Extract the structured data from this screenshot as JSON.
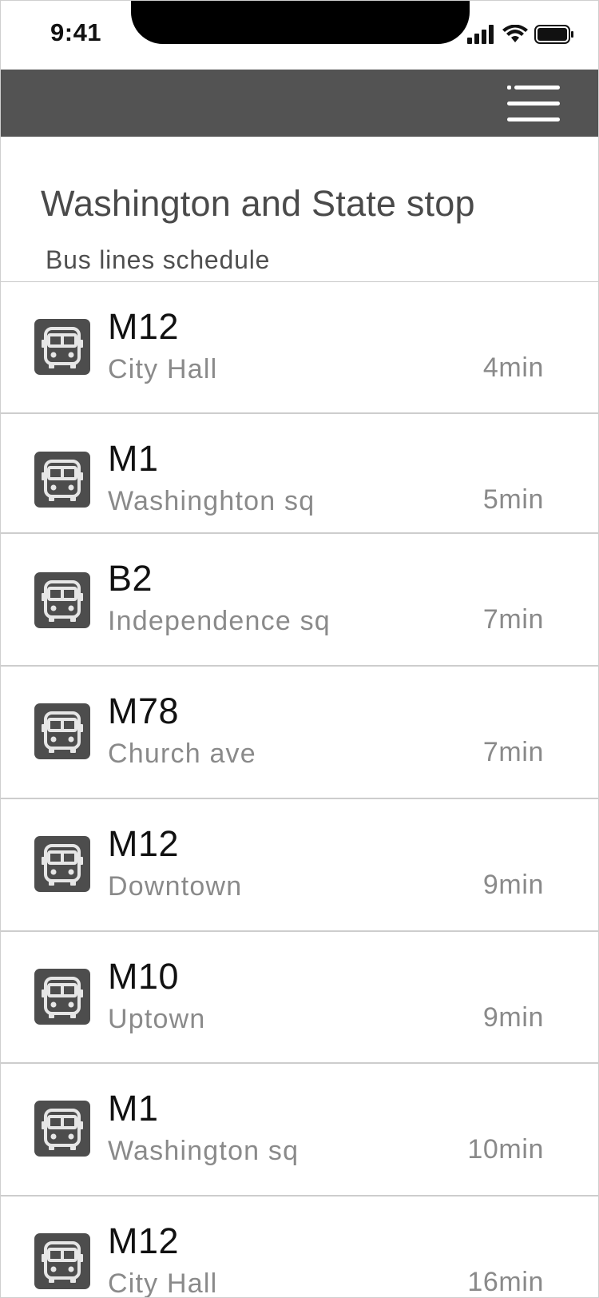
{
  "status_bar": {
    "time": "9:41",
    "icons": [
      "signal-icon",
      "wifi-icon",
      "battery-icon"
    ]
  },
  "topbar": {
    "menu_icon": "hamburger-menu-icon",
    "background": "#535353"
  },
  "header": {
    "title": "Washington and State stop",
    "subtitle": "Bus lines schedule"
  },
  "schedule": [
    {
      "line": "M12",
      "destination": "City Hall",
      "eta": "4min"
    },
    {
      "line": "M1",
      "destination": "Washinghton sq",
      "eta": "5min"
    },
    {
      "line": "B2",
      "destination": "Independence sq",
      "eta": "7min"
    },
    {
      "line": "M78",
      "destination": "Church ave",
      "eta": "7min"
    },
    {
      "line": "M12",
      "destination": "Downtown",
      "eta": "9min"
    },
    {
      "line": "M10",
      "destination": "Uptown",
      "eta": "9min"
    },
    {
      "line": "M1",
      "destination": "Washington sq",
      "eta": "10min"
    },
    {
      "line": "M12",
      "destination": "City Hall",
      "eta": "16min"
    }
  ],
  "row_icon": "bus-icon"
}
